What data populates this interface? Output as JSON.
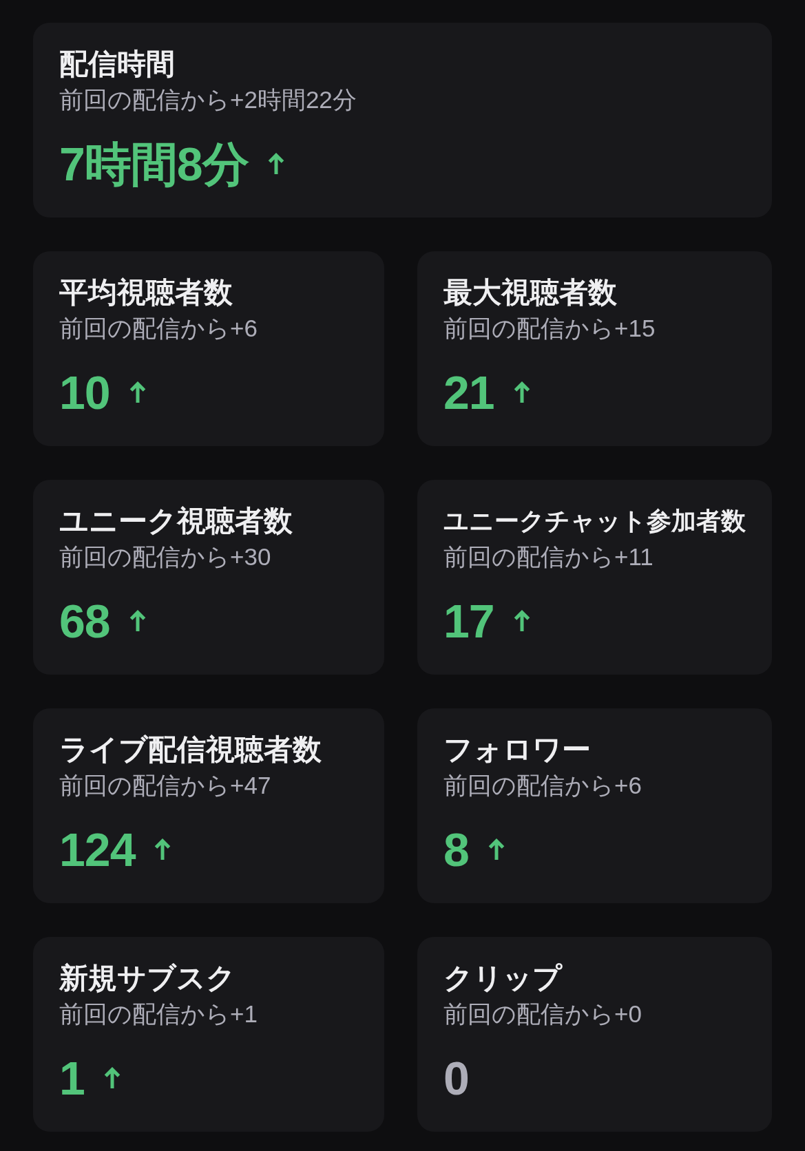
{
  "headline_card": {
    "title": "配信時間",
    "comparison": "前回の配信から+2時間22分",
    "value": "7時間8分",
    "increased": true
  },
  "cards": [
    {
      "title": "平均視聴者数",
      "comparison": "前回の配信から+6",
      "value": "10",
      "increased": true
    },
    {
      "title": "最大視聴者数",
      "comparison": "前回の配信から+15",
      "value": "21",
      "increased": true
    },
    {
      "title": "ユニーク視聴者数",
      "comparison": "前回の配信から+30",
      "value": "68",
      "increased": true
    },
    {
      "title": "ユニークチャット参加者数",
      "comparison": "前回の配信から+11",
      "value": "17",
      "increased": true
    },
    {
      "title": "ライブ配信視聴者数",
      "comparison": "前回の配信から+47",
      "value": "124",
      "increased": true
    },
    {
      "title": "フォロワー",
      "comparison": "前回の配信から+6",
      "value": "8",
      "increased": true
    },
    {
      "title": "新規サブスク",
      "comparison": "前回の配信から+1",
      "value": "1",
      "increased": true
    },
    {
      "title": "クリップ",
      "comparison": "前回の配信から+0",
      "value": "0",
      "increased": false
    }
  ]
}
